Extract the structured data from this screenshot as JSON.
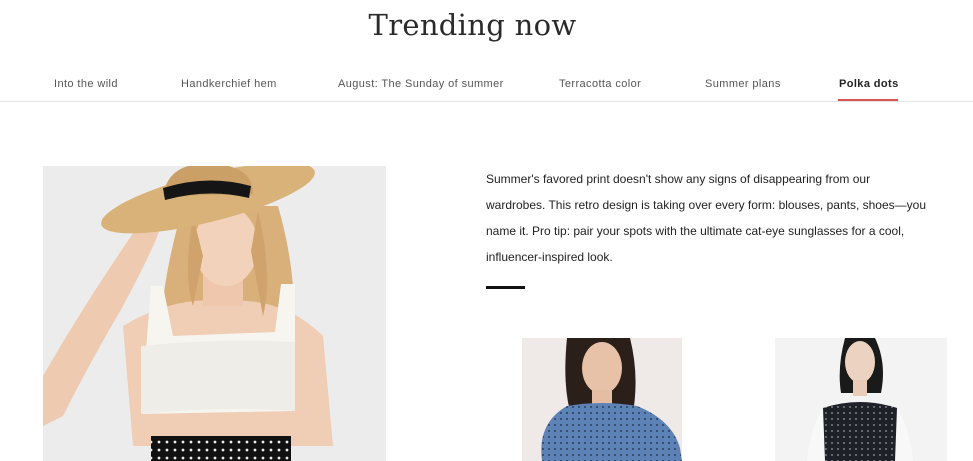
{
  "page": {
    "title": "Trending now"
  },
  "tabs": [
    {
      "label": "Into the wild"
    },
    {
      "label": "Handkerchief hem"
    },
    {
      "label": "August: The Sunday of summer"
    },
    {
      "label": "Terracotta color"
    },
    {
      "label": "Summer plans"
    },
    {
      "label": "Polka dots",
      "active": true
    }
  ],
  "feature": {
    "description": "Summer's favored print doesn't show any signs of disappearing from our wardrobes. This retro design is taking over every form: blouses, pants, shoes—you name it. Pro tip: pair your spots with the ultimate cat-eye sunglasses for a cool, influencer-inspired look."
  },
  "colors": {
    "accent": "#d9534f",
    "rule": "#111111"
  }
}
